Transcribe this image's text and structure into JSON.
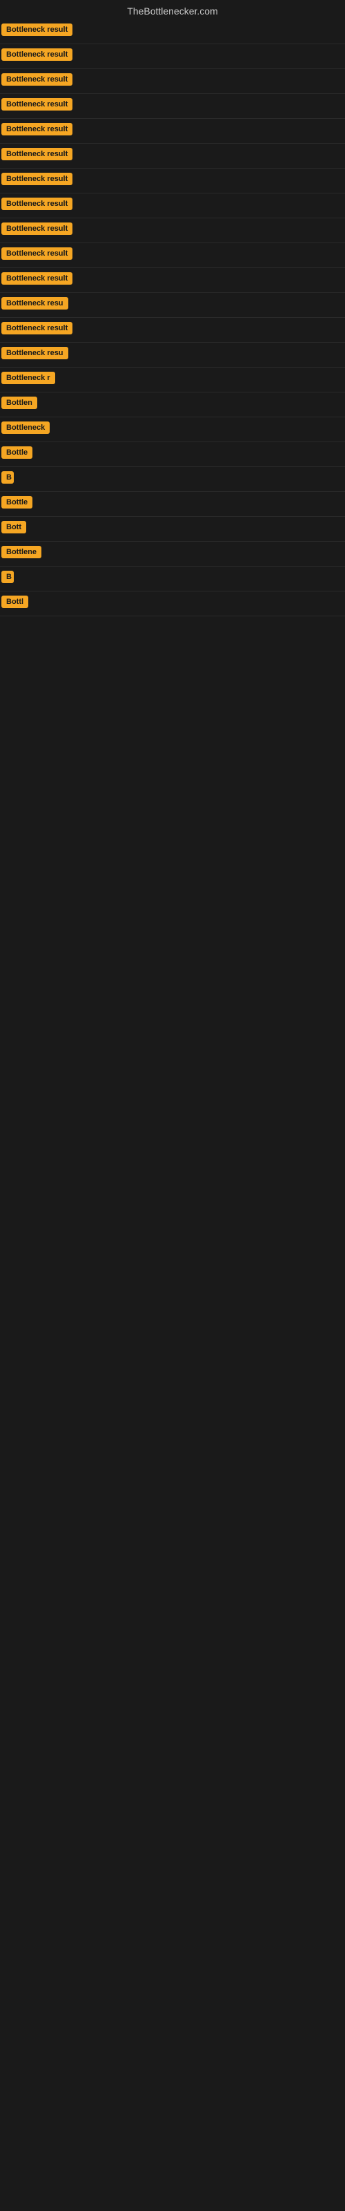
{
  "site": {
    "title": "TheBottlenecker.com"
  },
  "results": [
    {
      "id": 1,
      "label": "Bottleneck result",
      "width": 160
    },
    {
      "id": 2,
      "label": "Bottleneck result",
      "width": 160
    },
    {
      "id": 3,
      "label": "Bottleneck result",
      "width": 160
    },
    {
      "id": 4,
      "label": "Bottleneck result",
      "width": 160
    },
    {
      "id": 5,
      "label": "Bottleneck result",
      "width": 160
    },
    {
      "id": 6,
      "label": "Bottleneck result",
      "width": 160
    },
    {
      "id": 7,
      "label": "Bottleneck result",
      "width": 160
    },
    {
      "id": 8,
      "label": "Bottleneck result",
      "width": 160
    },
    {
      "id": 9,
      "label": "Bottleneck result",
      "width": 160
    },
    {
      "id": 10,
      "label": "Bottleneck result",
      "width": 160
    },
    {
      "id": 11,
      "label": "Bottleneck result",
      "width": 160
    },
    {
      "id": 12,
      "label": "Bottleneck resu",
      "width": 148
    },
    {
      "id": 13,
      "label": "Bottleneck result",
      "width": 160
    },
    {
      "id": 14,
      "label": "Bottleneck resu",
      "width": 148
    },
    {
      "id": 15,
      "label": "Bottleneck r",
      "width": 110
    },
    {
      "id": 16,
      "label": "Bottlen",
      "width": 72
    },
    {
      "id": 17,
      "label": "Bottleneck",
      "width": 95
    },
    {
      "id": 18,
      "label": "Bottle",
      "width": 62
    },
    {
      "id": 19,
      "label": "B",
      "width": 18
    },
    {
      "id": 20,
      "label": "Bottle",
      "width": 62
    },
    {
      "id": 21,
      "label": "Bott",
      "width": 46
    },
    {
      "id": 22,
      "label": "Bottlene",
      "width": 80
    },
    {
      "id": 23,
      "label": "B",
      "width": 18
    },
    {
      "id": 24,
      "label": "Bottl",
      "width": 54
    }
  ]
}
